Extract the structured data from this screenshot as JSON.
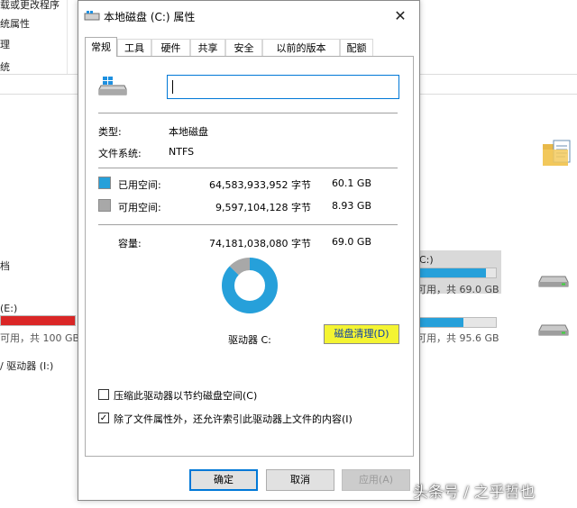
{
  "background": {
    "left_items": [
      "载或更改程序",
      "统属性",
      "理",
      "统"
    ],
    "drives": {
      "docs_label": "档",
      "e_drive": {
        "name": "(E:)",
        "space": "可用，共 100 GB",
        "fill_fraction": 1.0,
        "fill_color": "#da2626"
      },
      "i_drive": {
        "name": "/ 驱动器 (I:)"
      },
      "c_drive": {
        "name": "C:)",
        "space": "可用，共 69.0 GB",
        "fill_fraction": 0.87,
        "fill_color": "#26a0da"
      },
      "d_drive": {
        "name": "",
        "space": "可用，共 95.6 GB",
        "fill_fraction": 0.58,
        "fill_color": "#26a0da"
      }
    }
  },
  "dialog": {
    "title": "本地磁盘 (C:) 属性",
    "close_glyph": "✕",
    "tabs": [
      "常规",
      "工具",
      "硬件",
      "共享",
      "安全",
      "以前的版本",
      "配额"
    ],
    "active_tab": 0,
    "name_input_value": "",
    "type_label": "类型:",
    "type_value": "本地磁盘",
    "fs_label": "文件系统:",
    "fs_value": "NTFS",
    "used": {
      "label": "已用空间:",
      "bytes": "64,583,933,952 字节",
      "size": "60.1 GB",
      "color": "#26a0da"
    },
    "free": {
      "label": "可用空间:",
      "bytes": "9,597,104,128 字节",
      "size": "8.93 GB",
      "color": "#a8a8a8"
    },
    "capacity": {
      "label": "容量:",
      "bytes": "74,181,038,080 字节",
      "size": "69.0 GB"
    },
    "drive_label": "驱动器 C:",
    "cleanup_button": "磁盘清理(D)",
    "compress_label": "压缩此驱动器以节约磁盘空间(C)",
    "compress_checked": false,
    "index_label": "除了文件属性外，还允许索引此驱动器上文件的内容(I)",
    "index_checked": true,
    "check_glyph": "✓",
    "ok_button": "确定",
    "cancel_button": "取消",
    "apply_button": "应用(A)"
  },
  "chart_data": {
    "type": "pie",
    "categories": [
      "已用空间",
      "可用空间"
    ],
    "values": [
      64583933952,
      9597104128
    ],
    "colors": [
      "#26a0da",
      "#a8a8a8"
    ]
  },
  "watermark": "头条号 / 之乎哲也"
}
